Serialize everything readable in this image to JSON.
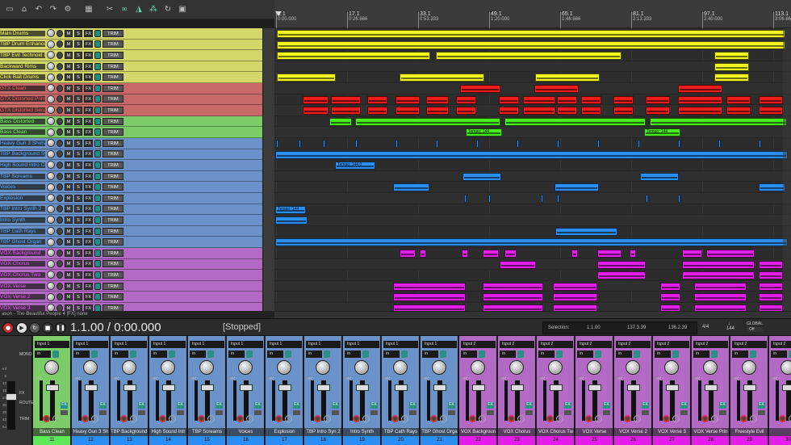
{
  "toolbar": {
    "icons": [
      "folder-icon",
      "save-icon",
      "undo-icon",
      "redo-icon",
      "settings-icon",
      "grid-icon",
      "cut-icon",
      "link-icon",
      "envelope-icon",
      "group-icon",
      "loop-icon",
      "lock-icon"
    ]
  },
  "ruler": {
    "marks": [
      {
        "bar": "1.1",
        "time": "0:00.000"
      },
      {
        "bar": "17.1",
        "time": "0:26.666"
      },
      {
        "bar": "33.1",
        "time": "0:53.333"
      },
      {
        "bar": "49.1",
        "time": "1:20.000"
      },
      {
        "bar": "65.1",
        "time": "1:46.666"
      },
      {
        "bar": "81.1",
        "time": "2:13.333"
      },
      {
        "bar": "97.1",
        "time": "2:40.000"
      },
      {
        "bar": "113.1",
        "time": "3:06.666"
      }
    ]
  },
  "tracks": [
    {
      "name": "Main Drums",
      "color": "#d4d86a",
      "text": "#fffc5a",
      "clip": "#f4f41e"
    },
    {
      "name": "TBP Drum Enhancer",
      "color": "#d4d86a",
      "text": "#fffc5a",
      "clip": "#f4f41e"
    },
    {
      "name": "TBP Evil Technoid Drums",
      "color": "#d4d86a",
      "text": "#fffc5a",
      "clip": "#f4f41e"
    },
    {
      "name": "Backward Rims",
      "color": "#d4d86a",
      "text": "#fffc5a",
      "clip": "#f4f41e"
    },
    {
      "name": "Click Bait Drums",
      "color": "#d4d86a",
      "text": "#fffc5a",
      "clip": "#f4f41e"
    },
    {
      "name": "GTX Clean",
      "color": "#c86a6a",
      "text": "#ff5a5a",
      "clip": "#ee1c1c"
    },
    {
      "name": "GTX Distorted Primary",
      "color": "#c86a6a",
      "text": "#ff5a5a",
      "clip": "#ee1c1c"
    },
    {
      "name": "GTX Distorted Secondary",
      "color": "#c86a6a",
      "text": "#ff5a5a",
      "clip": "#ee1c1c"
    },
    {
      "name": "Bass Distorted",
      "color": "#7ccc6a",
      "text": "#70ff60",
      "clip": "#48ee1c"
    },
    {
      "name": "Bass Clean",
      "color": "#7ccc6a",
      "text": "#70ff60",
      "clip": "#48ee1c"
    },
    {
      "name": "Heavy Gun 3 Shots",
      "color": "#6a92c8",
      "text": "#56a9ff",
      "clip": "#2b8ef0"
    },
    {
      "name": "TBP Background Synth",
      "color": "#6a92c8",
      "text": "#56a9ff",
      "clip": "#2b8ef0"
    },
    {
      "name": "High Sound Intro Chord",
      "color": "#6a92c8",
      "text": "#56a9ff",
      "clip": "#2b8ef0"
    },
    {
      "name": "TBP Screams",
      "color": "#6a92c8",
      "text": "#56a9ff",
      "clip": "#2b8ef0"
    },
    {
      "name": "Voices",
      "color": "#6a92c8",
      "text": "#56a9ff",
      "clip": "#2b8ef0"
    },
    {
      "name": "Explosion",
      "color": "#6a92c8",
      "text": "#56a9ff",
      "clip": "#2b8ef0"
    },
    {
      "name": "TBP Intro Synth 2",
      "color": "#6a92c8",
      "text": "#56a9ff",
      "clip": "#2b8ef0"
    },
    {
      "name": "Intro Synth",
      "color": "#6a92c8",
      "text": "#56a9ff",
      "clip": "#2b8ef0"
    },
    {
      "name": "TBP Cath Rays",
      "color": "#6a92c8",
      "text": "#56a9ff",
      "clip": "#2b8ef0"
    },
    {
      "name": "TBP Ghost Organ",
      "color": "#6a92c8",
      "text": "#56a9ff",
      "clip": "#2b8ef0"
    },
    {
      "name": "VOX Background",
      "color": "#b26ac4",
      "text": "#f050ff",
      "clip": "#e21ee8"
    },
    {
      "name": "VOX Chorus",
      "color": "#b26ac4",
      "text": "#f050ff",
      "clip": "#e21ee8"
    },
    {
      "name": "VOX Chorus Two",
      "color": "#b26ac4",
      "text": "#f050ff",
      "clip": "#e21ee8"
    },
    {
      "name": "VOX Verse",
      "color": "#b26ac4",
      "text": "#f050ff",
      "clip": "#e21ee8"
    },
    {
      "name": "VOX Verse 2",
      "color": "#b26ac4",
      "text": "#f050ff",
      "clip": "#e21ee8"
    },
    {
      "name": "VOX Verse 3",
      "color": "#b26ac4",
      "text": "#f050ff",
      "clip": "#e21ee8"
    }
  ],
  "track_buttons": {
    "mute": "M",
    "solo": "S",
    "fx": "FX",
    "trim": "TRIM"
  },
  "clip_labels": {
    "tempo_a": "Tempo: 144",
    "tempo_b": "Tempo: 144",
    "tempo_c": "Tempo: 144.0",
    "tempo_d": "Tempo: 144"
  },
  "project_bar": {
    "text": "ason - The Beautiful People 4 [FX] none"
  },
  "transport": {
    "time": "1.1.00 / 0:00.000",
    "status": "[Stopped]",
    "selection_label": "Selection:",
    "sel_start": "1.1.00",
    "sel_end": "137.3.39",
    "sel_length": "136.2.39",
    "timesig": "4/4",
    "tempo": "144",
    "global_label": "GLOBAL",
    "global_value": "Off"
  },
  "master": {
    "labels": [
      "MONO",
      "FX",
      "ROUTE",
      "TRIM"
    ],
    "scale": [
      "-inf",
      "6",
      "12",
      "18",
      "24",
      "30",
      "36",
      "42",
      "54"
    ]
  },
  "mixer": {
    "input_prefix": "Input",
    "in_label": "in",
    "neg_inf": "-inf",
    "fx_label": "FX",
    "strips": [
      {
        "name": "Bass Clean",
        "num": "11",
        "input": "Input 1",
        "color": "#7ccc6a",
        "numcolor": "#5fe85a"
      },
      {
        "name": "Heavy Gun 3 Sh",
        "num": "12",
        "input": "Input 1",
        "color": "#6a92c8",
        "numcolor": "#2b8ef0"
      },
      {
        "name": "TBP Background Syn",
        "num": "13",
        "input": "Input 1",
        "color": "#6a92c8",
        "numcolor": "#2b8ef0"
      },
      {
        "name": "High Sound Intr",
        "num": "14",
        "input": "Input 1",
        "color": "#6a92c8",
        "numcolor": "#2b8ef0"
      },
      {
        "name": "TBP Screams",
        "num": "15",
        "input": "Input 1",
        "color": "#6a92c8",
        "numcolor": "#2b8ef0"
      },
      {
        "name": "Voices",
        "num": "16",
        "input": "Input 1",
        "color": "#6a92c8",
        "numcolor": "#2b8ef0"
      },
      {
        "name": "Explosion",
        "num": "17",
        "input": "Input 1",
        "color": "#6a92c8",
        "numcolor": "#2b8ef0"
      },
      {
        "name": "TBP Intro Syn 2",
        "num": "18",
        "input": "Input 1",
        "color": "#6a92c8",
        "numcolor": "#2b8ef0"
      },
      {
        "name": "Intro Synth",
        "num": "19",
        "input": "Input 1",
        "color": "#6a92c8",
        "numcolor": "#2b8ef0"
      },
      {
        "name": "TBP Cath Rays",
        "num": "20",
        "input": "Input 1",
        "color": "#6a92c8",
        "numcolor": "#2b8ef0"
      },
      {
        "name": "TBP Ghost Orga",
        "num": "21",
        "input": "Input 1",
        "color": "#6a92c8",
        "numcolor": "#2b8ef0"
      },
      {
        "name": "VOX Backgroun",
        "num": "22",
        "input": "Input 2",
        "color": "#b26ac4",
        "numcolor": "#e21ee8"
      },
      {
        "name": "VOX Chorus",
        "num": "23",
        "input": "Input 2",
        "color": "#b26ac4",
        "numcolor": "#e21ee8"
      },
      {
        "name": "VOX Chorus Tw",
        "num": "24",
        "input": "Input 2",
        "color": "#b26ac4",
        "numcolor": "#e21ee8"
      },
      {
        "name": "VOX Verse",
        "num": "25",
        "input": "Input 2",
        "color": "#b26ac4",
        "numcolor": "#e21ee8"
      },
      {
        "name": "VOX Verse 2",
        "num": "26",
        "input": "Input 2",
        "color": "#b26ac4",
        "numcolor": "#e21ee8"
      },
      {
        "name": "VOX Verse 3",
        "num": "27",
        "input": "Input 2",
        "color": "#b26ac4",
        "numcolor": "#e21ee8"
      },
      {
        "name": "VOX Verse Prin",
        "num": "28",
        "input": "Input 2",
        "color": "#b26ac4",
        "numcolor": "#e21ee8"
      },
      {
        "name": "Freestyle Evil",
        "num": "29",
        "input": "Input 2",
        "color": "#b26ac4",
        "numcolor": "#e21ee8"
      },
      {
        "name": "",
        "num": "30",
        "input": "Input 2",
        "color": "#b26ac4",
        "numcolor": "#e21ee8"
      }
    ]
  }
}
